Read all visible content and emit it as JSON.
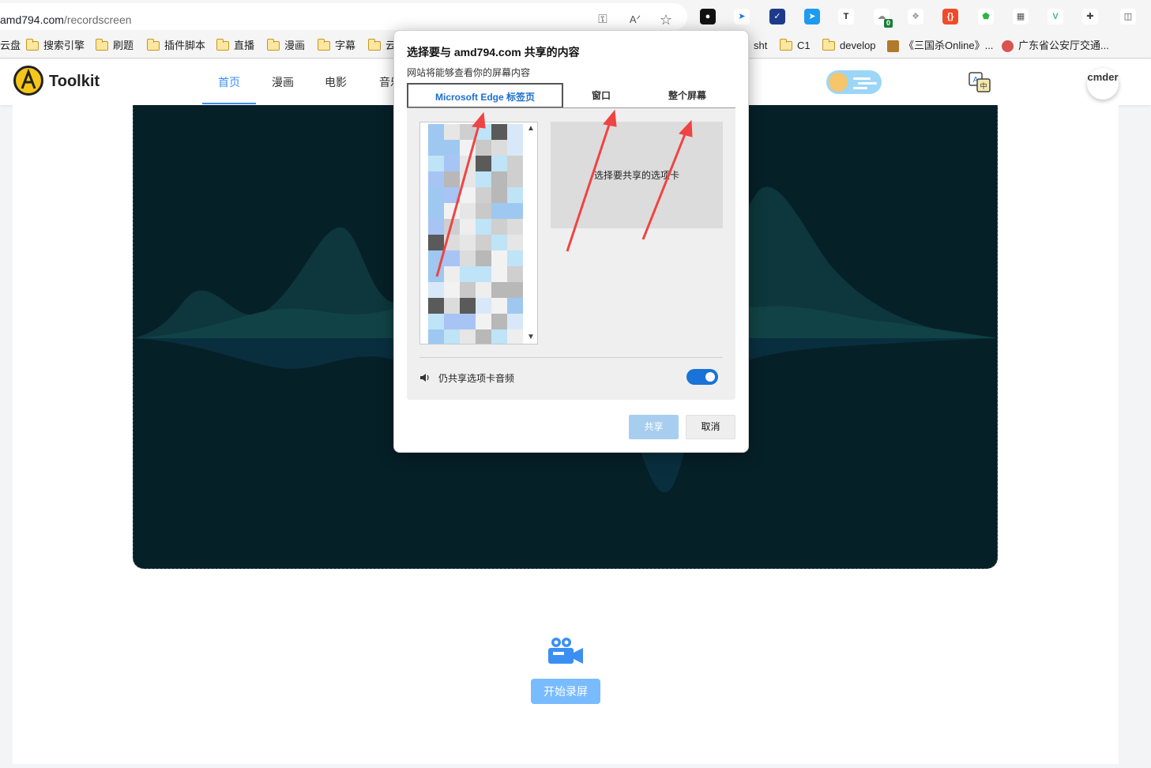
{
  "browser": {
    "url_host": "amd794.com",
    "url_path": "/recordscreen",
    "extensions": [
      {
        "name": "copilot-icon",
        "bg": "#111111",
        "glyph": "●"
      },
      {
        "name": "cursor-arrow-icon",
        "bg": "#ffffff",
        "glyph": "➤",
        "color": "#1a73e8"
      },
      {
        "name": "checkmark-badge-icon",
        "bg": "#1e3a8a",
        "glyph": "✓"
      },
      {
        "name": "telegram-icon",
        "bg": "#1d9bf0",
        "glyph": "➤"
      },
      {
        "name": "text-icon",
        "bg": "#ffffff",
        "glyph": "T",
        "color": "#222"
      },
      {
        "name": "cloud-counter-icon",
        "bg": "#ffffff",
        "glyph": "☁",
        "color": "#888",
        "badge": "0"
      },
      {
        "name": "flame-icon",
        "bg": "#ffffff",
        "glyph": "❖",
        "color": "#999"
      },
      {
        "name": "code-braces-icon",
        "bg": "#ef4b2a",
        "glyph": "{}"
      },
      {
        "name": "shield-icon",
        "bg": "#ffffff",
        "glyph": "⬟",
        "color": "#2fb34a"
      },
      {
        "name": "qr-code-icon",
        "bg": "#ffffff",
        "glyph": "▦",
        "color": "#555"
      },
      {
        "name": "vue-icon",
        "bg": "#ffffff",
        "glyph": "V",
        "color": "#41b883"
      },
      {
        "name": "extensions-puzzle-icon",
        "bg": "#ffffff",
        "glyph": "✚",
        "color": "#444"
      },
      {
        "name": "split-screen-icon",
        "bg": "#ffffff",
        "glyph": "◫",
        "color": "#444"
      }
    ],
    "bookmarks": [
      {
        "label": "云盘",
        "folder": false
      },
      {
        "label": "搜索引擎",
        "folder": true
      },
      {
        "label": "刷题",
        "folder": true
      },
      {
        "label": "插件脚本",
        "folder": true
      },
      {
        "label": "直播",
        "folder": true
      },
      {
        "label": "漫画",
        "folder": true
      },
      {
        "label": "字幕",
        "folder": true
      },
      {
        "label": "云",
        "folder": true
      },
      {
        "label": "sht",
        "folder": false
      },
      {
        "label": "C1",
        "folder": true
      },
      {
        "label": "develop",
        "folder": true
      },
      {
        "label": "《三国杀Online》...",
        "folder": false
      },
      {
        "label": "广东省公安厅交通...",
        "folder": false
      }
    ]
  },
  "site": {
    "logo_text": "Toolkit",
    "nav": [
      "首页",
      "漫画",
      "电影",
      "音乐"
    ],
    "avatar_text": "cmder",
    "record_button": "开始录屏"
  },
  "dialog": {
    "title": "选择要与 amd794.com 共享的内容",
    "subtitle": "网站将能够查看你的屏幕内容",
    "tabs": [
      "Microsoft Edge 标签页",
      "窗口",
      "整个屏幕"
    ],
    "active_tab": 0,
    "preview_text": "选择要共享的选项卡",
    "audio_label": "仍共享选项卡音频",
    "audio_enabled": true,
    "share_label": "共享",
    "cancel_label": "取消"
  },
  "colors": {
    "accent": "#3b8ff3",
    "dialog_accent": "#1a73d6",
    "dark_panel": "#062028",
    "annotation_arrow": "#ef4444"
  }
}
